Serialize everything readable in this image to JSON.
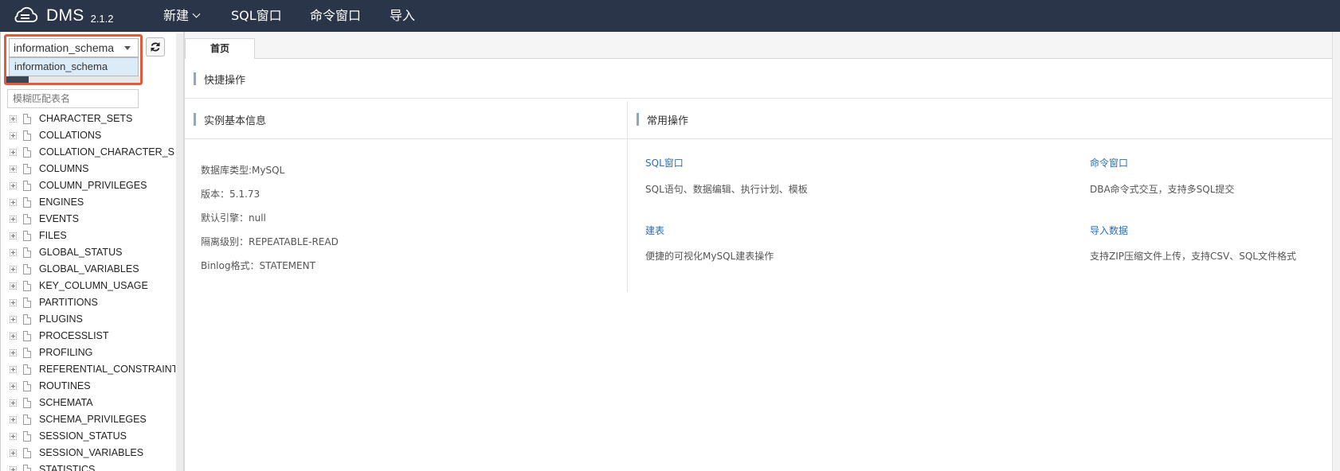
{
  "app": {
    "brand": "DMS",
    "version": "2.1.2"
  },
  "colors": {
    "topbar": "#2a3549",
    "highlight": "#e05b3a",
    "link": "#2a6ebb",
    "accent_bar": "#8aa9c4"
  },
  "topnav": {
    "new_label": "新建",
    "sql_window": "SQL窗口",
    "cmd_window": "命令窗口",
    "import": "导入"
  },
  "sidebar": {
    "db_selected": "information_schema",
    "dropdown_option": "information_schema",
    "filter_placeholder": "模糊匹配表名",
    "tables": [
      "CHARACTER_SETS",
      "COLLATIONS",
      "COLLATION_CHARACTER_SET_",
      "COLUMNS",
      "COLUMN_PRIVILEGES",
      "ENGINES",
      "EVENTS",
      "FILES",
      "GLOBAL_STATUS",
      "GLOBAL_VARIABLES",
      "KEY_COLUMN_USAGE",
      "PARTITIONS",
      "PLUGINS",
      "PROCESSLIST",
      "PROFILING",
      "REFERENTIAL_CONSTRAINTS",
      "ROUTINES",
      "SCHEMATA",
      "SCHEMA_PRIVILEGES",
      "SESSION_STATUS",
      "SESSION_VARIABLES",
      "STATISTICS"
    ]
  },
  "main": {
    "tab_home": "首页",
    "quick_ops_title": "快捷操作",
    "instance_info_title": "实例基本信息",
    "common_ops_title": "常用操作",
    "instance_info": {
      "db_type": "数据库类型:MySQL",
      "version": "版本：5.1.73",
      "default_engine": "默认引擎：null",
      "isolation": "隔离级别：REPEATABLE-READ",
      "binlog": "Binlog格式：STATEMENT"
    },
    "ops": {
      "sql_window": "SQL窗口",
      "sql_window_desc": "SQL语句、数据编辑、执行计划、模板",
      "cmd_window": "命令窗口",
      "cmd_window_desc": "DBA命令式交互，支持多SQL提交",
      "create_table": "建表",
      "create_table_desc": "便捷的可视化MySQL建表操作",
      "import_data": "导入数据",
      "import_data_desc": "支持ZIP压缩文件上传，支持CSV、SQL文件格式"
    }
  }
}
